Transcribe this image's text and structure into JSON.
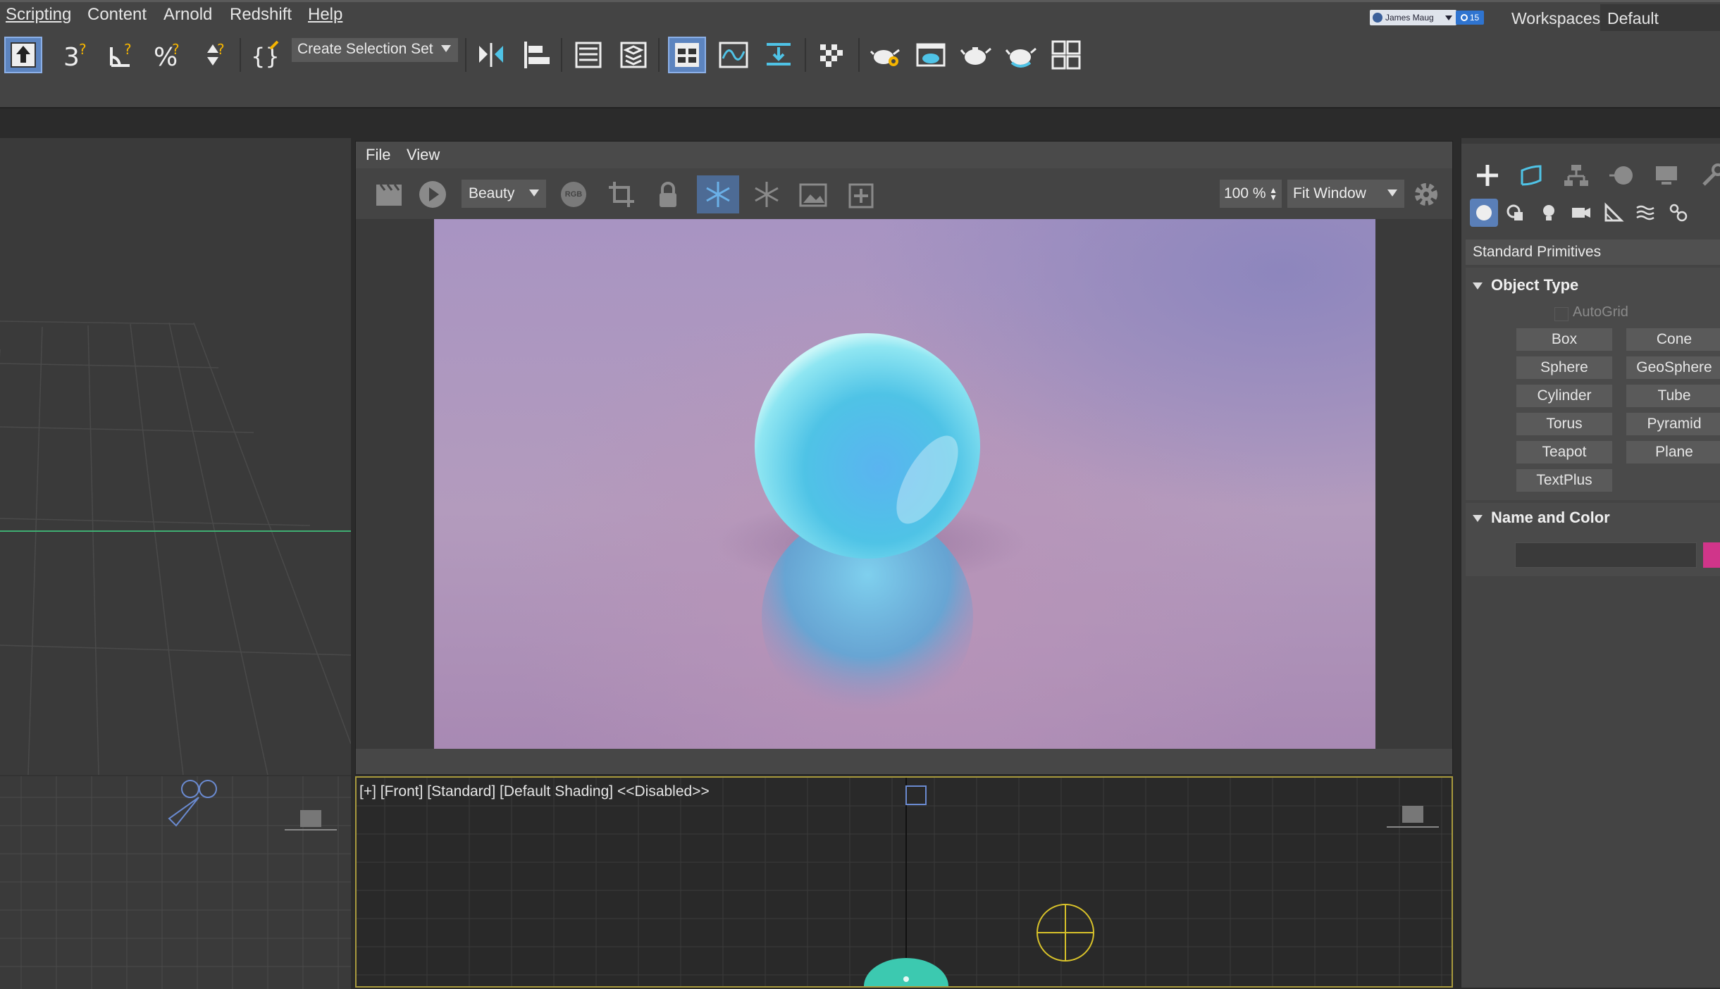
{
  "menubar": {
    "items": [
      "Scripting",
      "Content",
      "Arnold",
      "Redshift",
      "Help"
    ],
    "user_name": "James Maug",
    "notifications": "15",
    "workspaces_label": "Workspaces:",
    "workspace_value": "Default"
  },
  "toolbar": {
    "selection_set_label": "Create Selection Set"
  },
  "render_window": {
    "menu": [
      "File",
      "View"
    ],
    "channel": "Beauty",
    "rgb_label": "RGB",
    "zoom": "100 %",
    "fit": "Fit Window"
  },
  "front_viewport": {
    "label": "[+] [Front] [Standard] [Default Shading] <<Disabled>>"
  },
  "command_panel": {
    "category": "Standard Primitives",
    "object_type_title": "Object Type",
    "autogrid_label": "AutoGrid",
    "primitives": [
      "Box",
      "Cone",
      "Sphere",
      "GeoSphere",
      "Cylinder",
      "Tube",
      "Torus",
      "Pyramid",
      "Teapot",
      "Plane",
      "TextPlus"
    ],
    "name_color_title": "Name and Color",
    "object_color": "#d0358a"
  },
  "colors": {
    "accent_blue": "#5c84bf",
    "sphere": "#4fc3e6",
    "viewport_frame": "#a89a3d"
  }
}
